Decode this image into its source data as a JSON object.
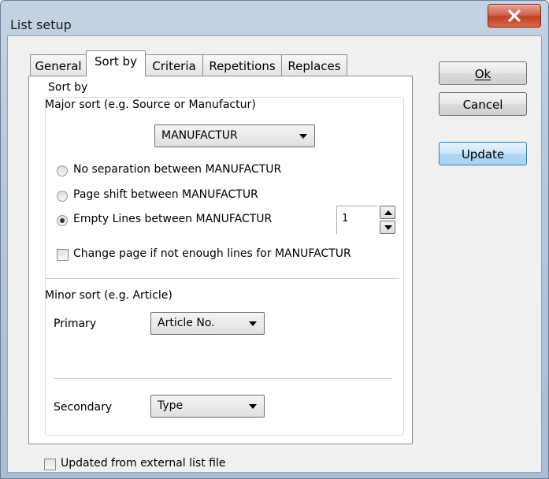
{
  "window": {
    "title": "List setup"
  },
  "tabs": [
    {
      "label": "General"
    },
    {
      "label": "Sort by"
    },
    {
      "label": "Criteria"
    },
    {
      "label": "Repetitions"
    },
    {
      "label": "Replaces"
    }
  ],
  "sort_by": {
    "group_title": "Sort by",
    "major_label": "Major sort (e.g. Source or Manufactur)",
    "major_value": "MANUFACTUR",
    "options": [
      {
        "label": "No separation between MANUFACTUR",
        "checked": false
      },
      {
        "label": "Page shift between MANUFACTUR",
        "checked": false
      },
      {
        "label": "Empty Lines between MANUFACTUR",
        "checked": true
      }
    ],
    "empty_lines_value": "1",
    "change_page_label": "Change page if not enough lines for MANUFACTUR",
    "minor_label": "Minor sort (e.g. Article)",
    "primary_label": "Primary",
    "primary_value": "Article No.",
    "secondary_label": "Secondary",
    "secondary_value": "Type"
  },
  "buttons": {
    "ok_label": "Ok",
    "cancel_label": "Cancel",
    "update_label": "Update"
  },
  "footer": {
    "updated_label": "Updated from external list file"
  }
}
